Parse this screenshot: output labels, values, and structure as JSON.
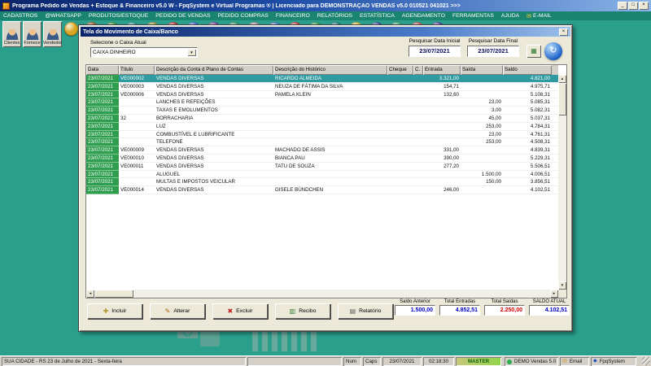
{
  "colors": {
    "desktop": "#2aa08c",
    "menubar": "#1b8470",
    "date_cell": "#2e9e4e",
    "selected_row": "#2f9ba0",
    "value_blue": "#0000c8",
    "value_red": "#d00000"
  },
  "window": {
    "title": "Programa Pedido de Vendas + Estoque & Financeiro v5.0 W - FpqSystem e Virtual Programas ® | Licenciado para DEMONSTRAÇÃO VENDAS v5.0 010521 041021 >>>",
    "minimize_glyph": "_",
    "maximize_glyph": "□",
    "close_glyph": "×"
  },
  "menu": {
    "items": [
      "CADASTROS",
      "@WHATSAPP",
      "PRODUTOS/ESTOQUE",
      "PEDIDO DE VENDAS",
      "PEDIDO COMPRAS",
      "FINANCEIRO",
      "RELATÓRIOS",
      "ESTATÍSTICA",
      "AGENDAMENTO",
      "FERRAMENTAS",
      "AJUDA"
    ],
    "email_label": "E-MAIL",
    "email_icon": "✉"
  },
  "toolbar": {
    "big_buttons": [
      {
        "label": "Clientes"
      },
      {
        "label": "Fornece"
      },
      {
        "label": "Vendedor"
      }
    ],
    "icons": [
      {
        "color": "#d8a520"
      },
      {
        "color": "#a0622d"
      },
      {
        "color": "#3a9d3a"
      },
      {
        "color": "#2a9d9d"
      },
      {
        "color": "#9d9d3a"
      },
      {
        "color": "#c03030"
      },
      {
        "color": "#3a6ad0"
      },
      {
        "color": "#8040a0"
      },
      {
        "color": "#40a070"
      },
      {
        "color": "#a0a0a8"
      },
      {
        "color": "#4080c0"
      },
      {
        "color": "#c04040"
      },
      {
        "color": "#30a050"
      },
      {
        "color": "#208080"
      },
      {
        "color": "#d0c040"
      },
      {
        "color": "#3050a0"
      },
      {
        "color": "#40b080"
      },
      {
        "color": "#c06060"
      },
      {
        "color": "#5040a0"
      }
    ]
  },
  "dialog": {
    "title": "Tela do Movimento de Caixa/Banco",
    "close_glyph": "×",
    "caixa_label": "Selecione o Caixa Atual",
    "caixa_value": "CAIXA DINHEIRO",
    "dropdown_glyph": "▼",
    "date_initial_label": "Pesquisar Data Inicial",
    "date_initial_value": "23/07/2021",
    "date_final_label": "Pesquisar Data Final",
    "date_final_value": "23/07/2021",
    "grid_button_glyph": "▦",
    "refresh_glyph": "↻",
    "scroll": {
      "up": "▲",
      "down": "▼",
      "left": "◄",
      "right": "►"
    },
    "table": {
      "columns": [
        "Data",
        "Título",
        "Descrição da Conta d Plano de Contas",
        "Descrição do Histórico",
        "Cheque",
        "C.",
        "Entrada",
        "Saída",
        "Saldo"
      ],
      "rows": [
        {
          "selected": true,
          "data": "23/07/2021",
          "titulo": "VE000002",
          "conta": "VENDAS DIVERSAS",
          "historico": "RICARDO ALMEIDA",
          "cheque": "",
          "c": "",
          "entrada": "3.321,00",
          "saida": "",
          "saldo": "4.821,00"
        },
        {
          "data": "23/07/2021",
          "titulo": "VE000003",
          "conta": "VENDAS DIVERSAS",
          "historico": "NEUZA DE FÁTIMA DA SILVA",
          "cheque": "",
          "c": "",
          "entrada": "154,71",
          "saida": "",
          "saldo": "4.975,71"
        },
        {
          "data": "23/07/2021",
          "titulo": "VE000006",
          "conta": "VENDAS DIVERSAS",
          "historico": "PAMELA KLEIN",
          "cheque": "",
          "c": "",
          "entrada": "132,60",
          "saida": "",
          "saldo": "5.108,31"
        },
        {
          "data": "23/07/2021",
          "titulo": "",
          "conta": "LANCHES E REFEIÇÕES",
          "historico": "",
          "cheque": "",
          "c": "",
          "entrada": "",
          "saida": "23,00",
          "saldo": "5.085,31"
        },
        {
          "data": "23/07/2021",
          "titulo": "",
          "conta": "TAXAS E EMOLUMENTOS",
          "historico": "",
          "cheque": "",
          "c": "",
          "entrada": "",
          "saida": "3,00",
          "saldo": "5.082,31"
        },
        {
          "data": "23/07/2021",
          "titulo": "32",
          "conta": "BORRACHARIA",
          "historico": "",
          "cheque": "",
          "c": "",
          "entrada": "",
          "saida": "45,00",
          "saldo": "5.037,31"
        },
        {
          "data": "23/07/2021",
          "titulo": "",
          "conta": "LUZ",
          "historico": "",
          "cheque": "",
          "c": "",
          "entrada": "",
          "saida": "253,00",
          "saldo": "4.784,31"
        },
        {
          "data": "23/07/2021",
          "titulo": "",
          "conta": "COMBUSTÍVEL E LUBRIFICANTE",
          "historico": "",
          "cheque": "",
          "c": "",
          "entrada": "",
          "saida": "23,00",
          "saldo": "4.761,31"
        },
        {
          "data": "23/07/2021",
          "titulo": "",
          "conta": "TELEFONE",
          "historico": "",
          "cheque": "",
          "c": "",
          "entrada": "",
          "saida": "253,00",
          "saldo": "4.508,31"
        },
        {
          "data": "23/07/2021",
          "titulo": "VE000009",
          "conta": "VENDAS DIVERSAS",
          "historico": "MACHADO DE ASSIS",
          "cheque": "",
          "c": "",
          "entrada": "331,00",
          "saida": "",
          "saldo": "4.839,31"
        },
        {
          "data": "23/07/2021",
          "titulo": "VE000010",
          "conta": "VENDAS DIVERSAS",
          "historico": "BIANCA PAU",
          "cheque": "",
          "c": "",
          "entrada": "390,00",
          "saida": "",
          "saldo": "5.229,31"
        },
        {
          "data": "23/07/2021",
          "titulo": "VE000011",
          "conta": "VENDAS DIVERSAS",
          "historico": "TATU DE SOUZA",
          "cheque": "",
          "c": "",
          "entrada": "277,20",
          "saida": "",
          "saldo": "5.506,51"
        },
        {
          "data": "23/07/2021",
          "titulo": "",
          "conta": "ALUGUEL",
          "historico": "",
          "cheque": "",
          "c": "",
          "entrada": "",
          "saida": "1.500,00",
          "saldo": "4.006,51"
        },
        {
          "data": "23/07/2021",
          "titulo": "",
          "conta": "MULTAS E IMPOSTOS VEICULAR",
          "historico": "",
          "cheque": "",
          "c": "",
          "entrada": "",
          "saida": "150,00",
          "saldo": "3.856,51"
        },
        {
          "data": "23/07/2021",
          "titulo": "VE000014",
          "conta": "VENDAS DIVERSAS",
          "historico": "GISELE BÜNDCHEN",
          "cheque": "",
          "c": "",
          "entrada": "246,00",
          "saida": "",
          "saldo": "4.102,51"
        }
      ]
    },
    "buttons": [
      {
        "label": "Incluir",
        "icon": "✚",
        "name": "incluir-button",
        "icon_color": "#b8932a"
      },
      {
        "label": "Alterar",
        "icon": "✎",
        "name": "alterar-button",
        "icon_color": "#b06a10"
      },
      {
        "label": "Excluir",
        "icon": "✖",
        "name": "excluir-button",
        "icon_color": "#c42020"
      },
      {
        "label": "Recibo",
        "icon": "▥",
        "name": "recibo-button",
        "icon_color": "#3a7a3a"
      },
      {
        "label": "Relatório",
        "icon": "▤",
        "name": "relatorio-button",
        "icon_color": "#606060"
      }
    ],
    "summary": [
      {
        "label": "Saldo Anterior",
        "value": "1.500,00",
        "name": "saldo-anterior-field"
      },
      {
        "label": "Total Entradas",
        "value": "4.852,51",
        "name": "total-entradas-field"
      },
      {
        "label": "Total Saídas",
        "value": "2.250,00",
        "name": "total-saidas-field",
        "class": "red"
      },
      {
        "label": "SALDO ATUAL",
        "value": "4.102,51",
        "name": "saldo-atual-field"
      }
    ]
  },
  "statusbar": {
    "location": "SUA CIDADE - RS 23 de Julho de 2021 - Sexta-feira",
    "num": "Num",
    "caps": "Caps",
    "date": "23/07/2021",
    "time": "02:18:30",
    "master": "MASTER",
    "demo": "DEMO Vendas 5.0",
    "email": "Email",
    "brand": "FpqSystem"
  },
  "decorations": {
    "phone_glyph": "☎"
  }
}
